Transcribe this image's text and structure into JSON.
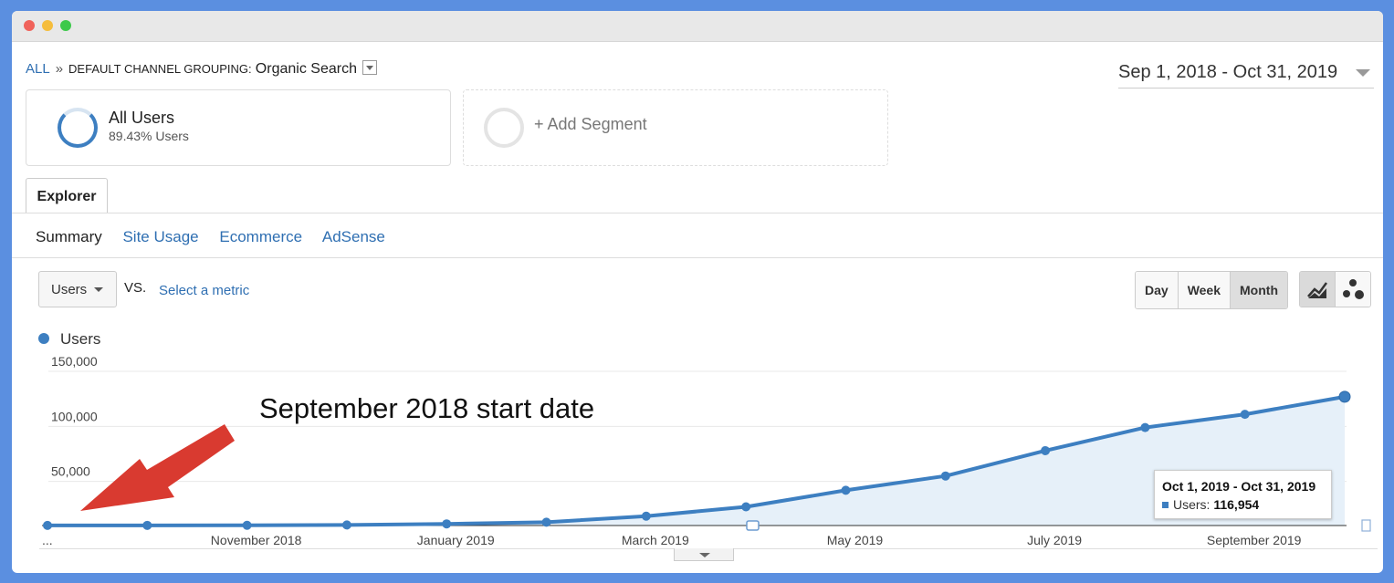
{
  "window": {
    "controls": [
      "close",
      "minimize",
      "zoom"
    ]
  },
  "breadcrumb": {
    "root": "ALL",
    "separator": "»",
    "key": "DEFAULT CHANNEL GROUPING:",
    "value": "Organic Search"
  },
  "date_range": "Sep 1, 2018 - Oct 31, 2019",
  "segments": {
    "active": {
      "title": "All Users",
      "subtitle": "89.43% Users",
      "percent": 89.43
    },
    "add_label": "+ Add Segment"
  },
  "tab": {
    "label": "Explorer"
  },
  "subnav": {
    "items": [
      {
        "label": "Summary",
        "active": true
      },
      {
        "label": "Site Usage",
        "active": false
      },
      {
        "label": "Ecommerce",
        "active": false
      },
      {
        "label": "AdSense",
        "active": false
      }
    ]
  },
  "controls": {
    "metric": "Users",
    "vs": "VS.",
    "select_metric": "Select a metric",
    "granularity": [
      "Day",
      "Week",
      "Month"
    ],
    "granularity_selected": "Month",
    "chart_types": [
      "line-chart-icon",
      "motion-chart-icon"
    ],
    "chart_type_selected": "line-chart-icon"
  },
  "legend": {
    "label": "Users",
    "color": "#3d7fc1"
  },
  "annotation": {
    "text": "September 2018 start date",
    "arrow_color": "#d93a30"
  },
  "tooltip": {
    "title": "Oct 1, 2019 - Oct 31, 2019",
    "series": "Users:",
    "value": "116,954"
  },
  "chart_data": {
    "type": "area",
    "series": [
      {
        "name": "Users",
        "color": "#3d7fc1",
        "points": [
          {
            "x": "2018-09",
            "y": 100
          },
          {
            "x": "2018-10",
            "y": 150
          },
          {
            "x": "2018-11",
            "y": 200
          },
          {
            "x": "2018-12",
            "y": 500
          },
          {
            "x": "2019-01",
            "y": 1500
          },
          {
            "x": "2019-02",
            "y": 3000
          },
          {
            "x": "2019-03",
            "y": 8500
          },
          {
            "x": "2019-04",
            "y": 17000
          },
          {
            "x": "2019-05",
            "y": 32000
          },
          {
            "x": "2019-06",
            "y": 45000
          },
          {
            "x": "2019-07",
            "y": 68000
          },
          {
            "x": "2019-08",
            "y": 89000
          },
          {
            "x": "2019-09",
            "y": 101000
          },
          {
            "x": "2019-10",
            "y": 116954
          }
        ]
      }
    ],
    "x_tick_labels": [
      "...",
      "November 2018",
      "January 2019",
      "March 2019",
      "May 2019",
      "July 2019",
      "September 2019"
    ],
    "y_ticks": [
      "150,000",
      "100,000",
      "50,000"
    ],
    "ylim": [
      0,
      150000
    ],
    "grid": true,
    "fill": "#e6f0f9"
  }
}
